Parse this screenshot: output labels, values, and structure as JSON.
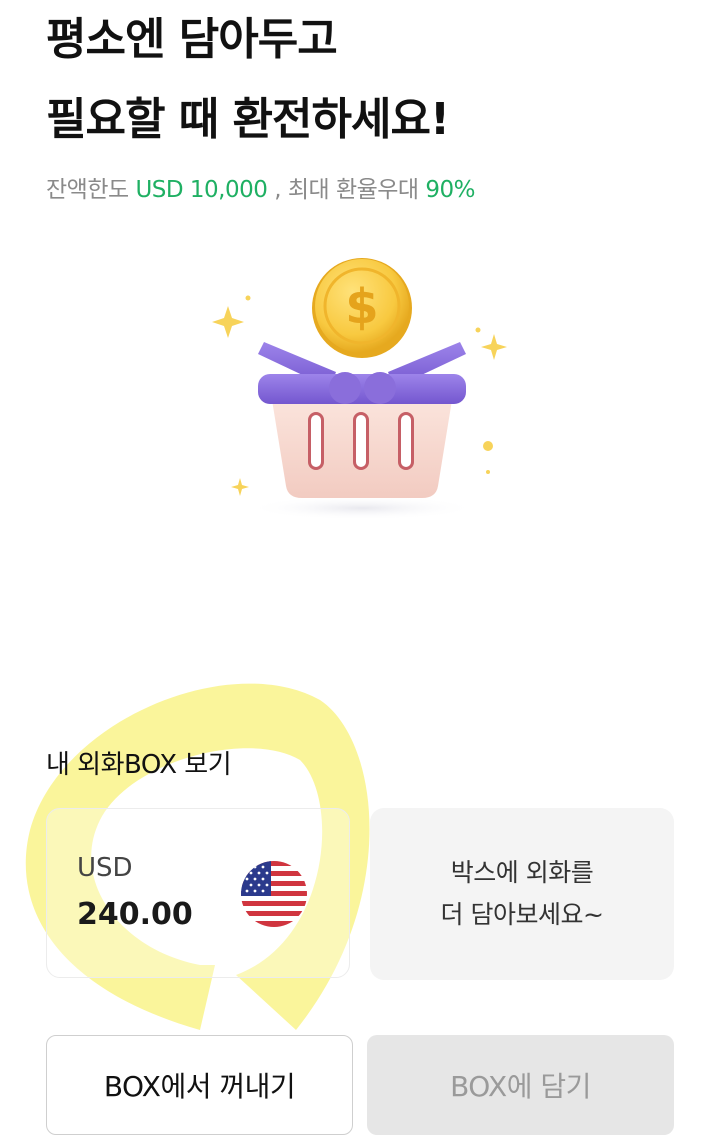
{
  "headline": {
    "line1": "평소엔 담아두고",
    "line2": "필요할 때 환전하세요!"
  },
  "subline": {
    "prefix": "잔액한도 ",
    "limit": "USD 10,000",
    "middle": " , 최대 환율우대 ",
    "rate": "90%"
  },
  "illustration": {
    "icon": "basket-with-dollar-coin-icon",
    "coin_symbol": "$"
  },
  "box_section": {
    "title": "내 외화BOX 보기",
    "currency": {
      "code": "USD",
      "amount": "240.00",
      "flag_icon": "us-flag-icon"
    },
    "promo": {
      "line1": "박스에 외화를",
      "line2": "더 담아보세요~"
    }
  },
  "buttons": {
    "take_out": "BOX에서 꺼내기",
    "put_in": "BOX에 담기"
  },
  "colors": {
    "accent_green": "#1fb063",
    "highlight_yellow": "#f8f27a",
    "basket_purple": "#8b6fd8",
    "coin_gold": "#f5c242"
  }
}
